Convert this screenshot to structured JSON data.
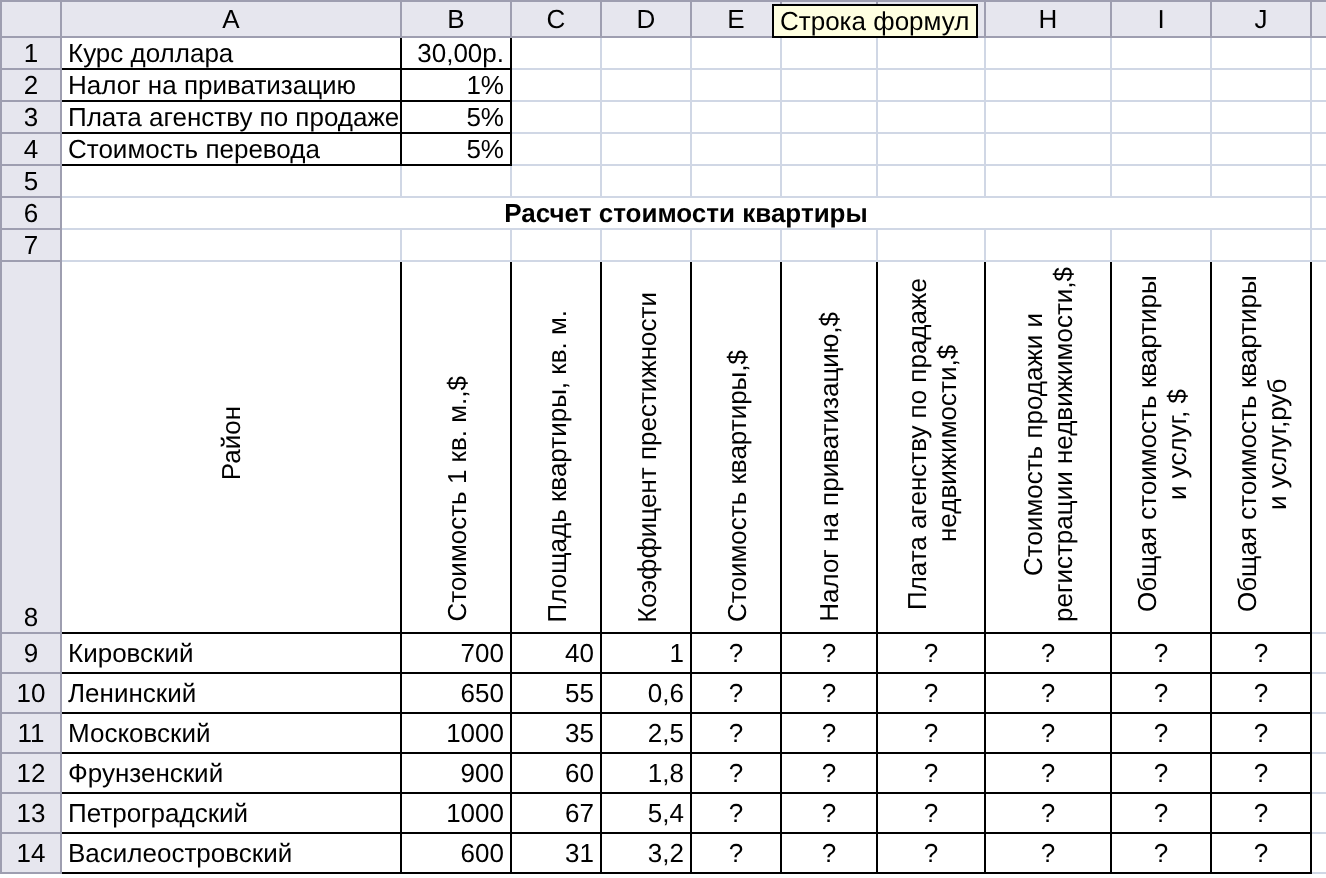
{
  "column_headers": [
    {
      "label": "A"
    },
    {
      "label": "B"
    },
    {
      "label": "C"
    },
    {
      "label": "D"
    },
    {
      "label": "E"
    },
    {
      "covered": true
    },
    {
      "covered": true
    },
    {
      "label": "H"
    },
    {
      "label": "I"
    },
    {
      "label": "J"
    }
  ],
  "tooltip": "Строка формул",
  "row_numbers": [
    "1",
    "2",
    "3",
    "4",
    "5",
    "6",
    "7",
    "8",
    "9",
    "10",
    "11",
    "12",
    "13",
    "14"
  ],
  "parameters": [
    {
      "label": "Курс доллара",
      "value": "30,00р."
    },
    {
      "label": "Налог на приватизацию",
      "value": "1%"
    },
    {
      "label": "Плата агенству по продаже",
      "value": "5%"
    },
    {
      "label": "Стоимость перевода",
      "value": "5%"
    }
  ],
  "title": "Расчет стоимости квартиры",
  "table_headers": [
    "Район",
    "Стоимость 1 кв. м.,$",
    "Площадь квартиры, кв. м.",
    "Коэффицент престижности",
    "Стоимость квартиры,$",
    "Налог на приватизацию,$",
    "Плата агенству по прадаже недвижимости,$",
    "Стоимость продажи и регистрации недвижимости,$",
    "Общая стоимость квартиры и услуг, $",
    "Общая стоимость квартиры и услуг,руб"
  ],
  "rows": [
    [
      "Кировский",
      "700",
      "40",
      "1",
      "?",
      "?",
      "?",
      "?",
      "?",
      "?"
    ],
    [
      "Ленинский",
      "650",
      "55",
      "0,6",
      "?",
      "?",
      "?",
      "?",
      "?",
      "?"
    ],
    [
      "Московский",
      "1000",
      "35",
      "2,5",
      "?",
      "?",
      "?",
      "?",
      "?",
      "?"
    ],
    [
      "Фрунзенский",
      "900",
      "60",
      "1,8",
      "?",
      "?",
      "?",
      "?",
      "?",
      "?"
    ],
    [
      "Петроградский",
      "1000",
      "67",
      "5,4",
      "?",
      "?",
      "?",
      "?",
      "?",
      "?"
    ],
    [
      "Василеостровский",
      "600",
      "31",
      "3,2",
      "?",
      "?",
      "?",
      "?",
      "?",
      "?"
    ]
  ]
}
